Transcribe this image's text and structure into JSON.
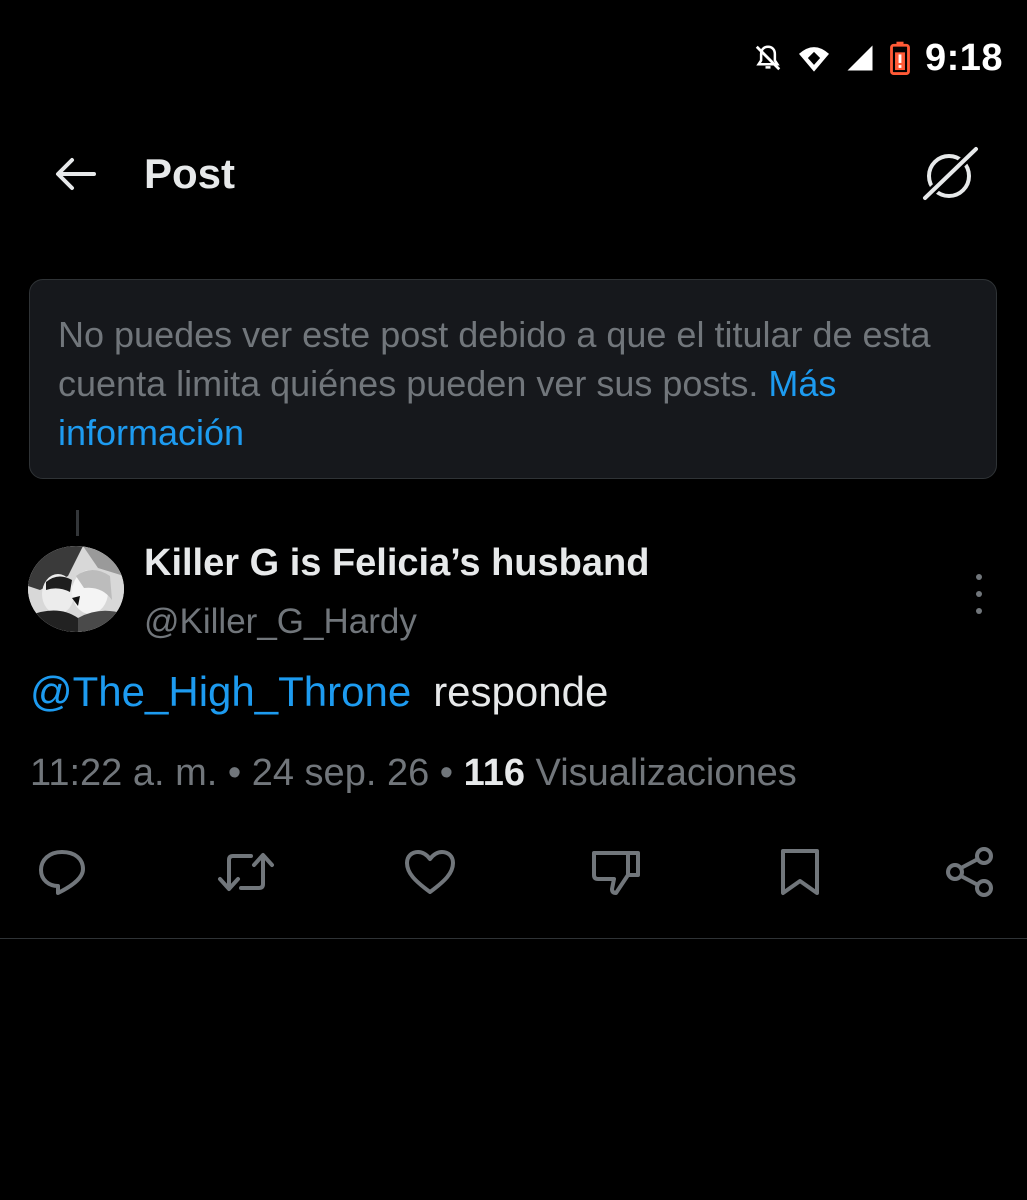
{
  "status_bar": {
    "time": "9:18",
    "icons": [
      "bell-muted-icon",
      "wifi-icon",
      "signal-icon",
      "battery-low-icon"
    ],
    "battery_color": "#ff5a36"
  },
  "header": {
    "title": "Post",
    "back_icon": "arrow-left-icon",
    "grok_icon": "grok-icon"
  },
  "notice": {
    "text": "No puedes ver este post debido a que el titular de esta cuenta limita quiénes pueden ver sus posts. ",
    "link": "Más información"
  },
  "post": {
    "author": {
      "name": "Killer G is Felicia’s husband",
      "handle": "@Killer_G_Hardy"
    },
    "mention": "@The_High_Throne",
    "text": "responde",
    "time": "11:22 a. m.",
    "date": "24 sep. 26",
    "views_count": "116",
    "views_label": "Visualizaciones"
  },
  "actions": [
    "reply-icon",
    "repost-icon",
    "like-icon",
    "dislike-icon",
    "bookmark-icon",
    "share-icon"
  ],
  "colors": {
    "background": "#000000",
    "accent": "#1d9bf0",
    "text_primary": "#e7e9ea",
    "text_secondary": "#71767b",
    "notice_bg": "#16181c",
    "border": "#2f3336"
  }
}
